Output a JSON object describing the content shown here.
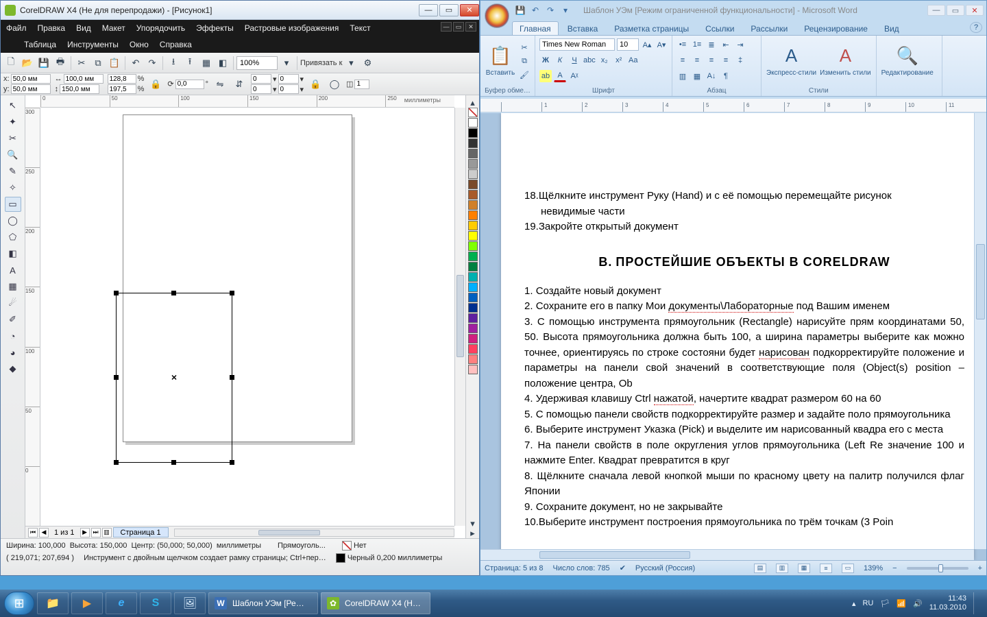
{
  "corel": {
    "title": "CorelDRAW X4 (Не для перепродажи) - [Рисунок1]",
    "menus1": [
      "Файл",
      "Правка",
      "Вид",
      "Макет",
      "Упорядочить",
      "Эффекты",
      "Растровые изображения",
      "Текст"
    ],
    "menus2": [
      "Таблица",
      "Инструменты",
      "Окно",
      "Справка"
    ],
    "zoom": "100%",
    "snap": "Привязать к",
    "prop": {
      "x_label": "x:",
      "x": "50,0 мм",
      "y_label": "y:",
      "y": "50,0 мм",
      "w": "100,0 мм",
      "h": "150,0 мм",
      "sx": "128,8",
      "sy": "197,5",
      "pct": "%",
      "rot": "0,0",
      "deg": "°",
      "corner": "0",
      "one": "1"
    },
    "ruler_h": [
      "0",
      "50",
      "100",
      "150",
      "200",
      "250"
    ],
    "ruler_units": "миллиметры",
    "ruler_v": [
      "300",
      "250",
      "200",
      "150",
      "100",
      "50",
      "0"
    ],
    "palette": [
      "",
      "#ffffff",
      "#000000",
      "#333333",
      "#666666",
      "#999999",
      "#cccccc",
      "#7a4a2a",
      "#a85a2a",
      "#d0802a",
      "#ff8000",
      "#ffcc00",
      "#ffff00",
      "#80ff00",
      "#00b050",
      "#008040",
      "#00b0b0",
      "#00b0ff",
      "#0060c0",
      "#003090",
      "#6020a0",
      "#a020a0",
      "#d02080",
      "#ff4060",
      "#ff8080",
      "#ffc0c0"
    ],
    "page_nav": {
      "count": "1 из 1",
      "page": "Страница 1"
    },
    "status": {
      "shirina": "Ширина: 100,000",
      "vysota": "Высота: 150,000",
      "centr": "Центр: (50,000; 50,000)",
      "mm": "миллиметры",
      "obj": "Прямоуголь...",
      "net": "Нет",
      "coords": "( 219,071; 207,694 )",
      "hint": "Инструмент с двойным щелчком создает рамку страницы; Ctrl+пер…",
      "outline": "Черный  0,200 миллиметры"
    }
  },
  "word": {
    "title": "Шаблон УЭм [Режим ограниченной функциональности] - Microsoft Word",
    "tabs": [
      "Главная",
      "Вставка",
      "Разметка страницы",
      "Ссылки",
      "Рассылки",
      "Рецензирование",
      "Вид"
    ],
    "clipboard_label": "Буфер обме…",
    "clipboard_btn": "Вставить",
    "font": {
      "name": "Times New Roman",
      "size": "10",
      "group": "Шрифт"
    },
    "para_group": "Абзац",
    "styles": {
      "quick": "Экспресс-стили",
      "change": "Изменить стили",
      "group": "Стили"
    },
    "editing": "Редактирование",
    "ruler": [
      "",
      "1",
      "2",
      "3",
      "4",
      "5",
      "6",
      "7",
      "8",
      "9",
      "10",
      "11",
      "12"
    ],
    "doc": {
      "l18": "Щёлкните инструмент Руку (Hand) и с её помощью перемещайте рисунок",
      "l18b": "невидимые части",
      "l19": "Закройте открытый документ",
      "heading_letter": "В.",
      "heading": "ПРОСТЕЙШИЕ ОБЪЕКТЫ В CORELDRAW",
      "i1": "Создайте новый документ",
      "i2a": "Сохраните его в папку Мои ",
      "i2b": "документы\\Лабораторные",
      "i2c": "  под Вашим именем",
      "i3": "С помощью инструмента прямоугольник (Rectangle) нарисуйте прям координатами 50, 50. Высота прямоугольника должна быть 100, а ширина параметры выберите как можно точнее, ориентируясь по строке состояни будет ",
      "i3b": "нарисован",
      "i3c": " подкорректируйте положение и параметры на панели свой значений в соответствующие поля (Object(s) position – положение центра, Ob",
      "i4a": "Удерживая клавишу Ctrl ",
      "i4b": "нажатой",
      "i4c": ", начертите квадрат размером 60 на 60",
      "i5": "С помощью панели свойств подкорректируйте размер и задайте поло прямоугольника",
      "i6": "Выберите инструмент Указка (Pick) и выделите им нарисованный квадра его с места",
      "i7": "На панели свойств в поле округления углов прямоугольника (Left Re значение 100 и нажмите Enter. Квадрат превратится в круг",
      "i8": "Щёлкните сначала левой кнопкой мыши по красному цвету на палитр получился флаг Японии",
      "i9": "Сохраните документ, но не закрывайте",
      "i10": "Выберите инструмент построения прямоугольника по трём точкам (3 Poin"
    },
    "status": {
      "page": "Страница: 5 из 8",
      "words": "Число слов: 785",
      "lang": "Русский (Россия)",
      "zoom": "139%"
    }
  },
  "taskbar": {
    "apps": [
      {
        "icon": "📁"
      },
      {
        "icon": "▶",
        "color": "#f7a43a"
      },
      {
        "icon": "e",
        "color": "#3db2ff"
      },
      {
        "icon": "S",
        "color": "#2fb4ea"
      },
      {
        "icon": "🖼"
      }
    ],
    "open": [
      {
        "label": "Шаблон УЭм [Ре…",
        "icon": "W"
      },
      {
        "label": "CorelDRAW X4 (Н…",
        "icon": "✿"
      }
    ],
    "tray": {
      "lang": "RU",
      "time": "11:43",
      "date": "11.03.2010"
    }
  }
}
